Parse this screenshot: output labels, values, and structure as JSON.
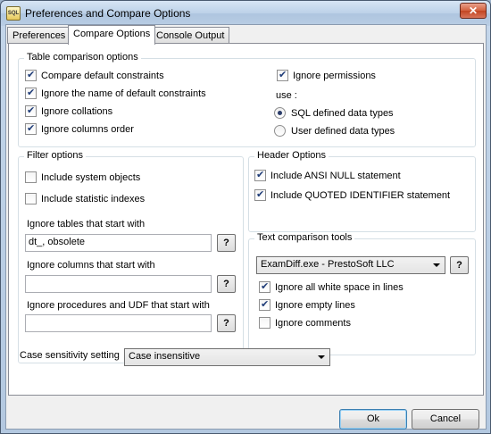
{
  "window": {
    "title": "Preferences and Compare Options",
    "icon_text": "SQL",
    "close_glyph": "✕"
  },
  "tabs": [
    {
      "label": "Preferences",
      "active": false
    },
    {
      "label": "Compare Options",
      "active": true
    },
    {
      "label": "Console Output",
      "active": false
    }
  ],
  "table_options": {
    "title": "Table comparison options",
    "items": [
      {
        "label": "Compare default constraints",
        "checked": true
      },
      {
        "label": "Ignore the name of default constraints",
        "checked": true
      },
      {
        "label": "Ignore collations",
        "checked": true
      },
      {
        "label": "Ignore columns order",
        "checked": true
      }
    ],
    "ignore_permissions": {
      "label": "Ignore permissions",
      "checked": true
    },
    "use_label": "use :",
    "radios": [
      {
        "label": "SQL defined data types",
        "checked": true
      },
      {
        "label": "User defined data types",
        "checked": false
      }
    ]
  },
  "filter_options": {
    "title": "Filter options",
    "include_system_objects": {
      "label": "Include system objects",
      "checked": false
    },
    "include_statistic_indexes": {
      "label": "Include statistic indexes",
      "checked": false
    },
    "ignore_tables": {
      "label": "Ignore tables that start with",
      "value": "dt_, obsolete"
    },
    "ignore_columns": {
      "label": "Ignore columns that start with",
      "value": ""
    },
    "ignore_procedures": {
      "label": "Ignore procedures and UDF that start with",
      "value": ""
    },
    "help_label": "?"
  },
  "header_options": {
    "title": "Header Options",
    "ansi_null": {
      "label": "Include ANSI NULL statement",
      "checked": true
    },
    "quoted_identifier": {
      "label": "Include QUOTED IDENTIFIER statement",
      "checked": true
    }
  },
  "text_tools": {
    "title": "Text comparison tools",
    "selected_tool": "ExamDiff.exe - PrestoSoft LLC",
    "help_label": "?",
    "ignore_white_space": {
      "label": "Ignore all white space in lines",
      "checked": true
    },
    "ignore_empty_lines": {
      "label": "Ignore empty lines",
      "checked": true
    },
    "ignore_comments": {
      "label": "Ignore comments",
      "checked": false
    }
  },
  "case_sensitivity": {
    "label": "Case sensitivity setting",
    "selected": "Case insensitive"
  },
  "buttons": {
    "ok": "Ok",
    "cancel": "Cancel"
  }
}
